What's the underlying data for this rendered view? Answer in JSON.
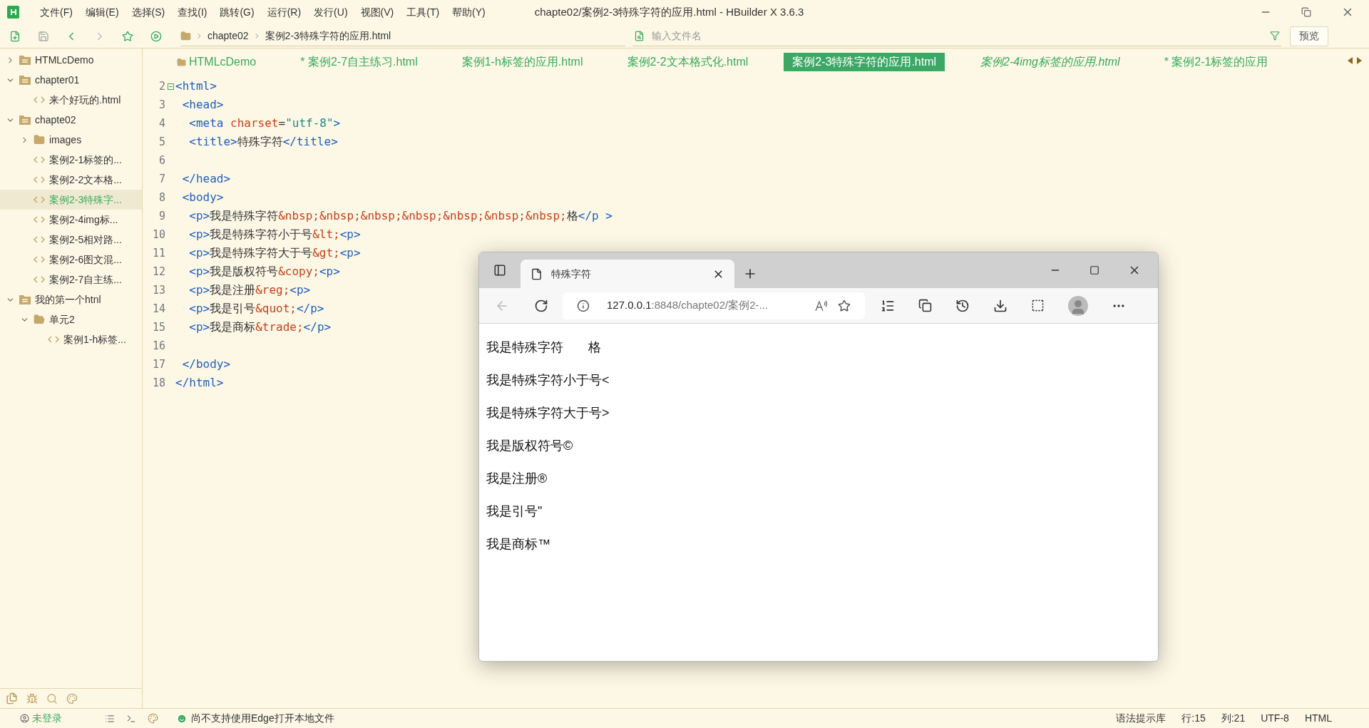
{
  "window": {
    "title": "chapte02/案例2-3特殊字符的应用.html - HBuilder X 3.6.3"
  },
  "menu": [
    "文件(F)",
    "编辑(E)",
    "选择(S)",
    "查找(I)",
    "跳转(G)",
    "运行(R)",
    "发行(U)",
    "视图(V)",
    "工具(T)",
    "帮助(Y)"
  ],
  "breadcrumb": [
    "chapte02",
    "案例2-3特殊字符的应用.html"
  ],
  "file_search": {
    "placeholder": "输入文件名"
  },
  "preview_button": "预览",
  "project_tree": [
    {
      "label": "HTMLcDemo",
      "kind": "project",
      "expanded": false,
      "selected": false
    },
    {
      "label": "chapter01",
      "kind": "project",
      "expanded": true,
      "selected": false,
      "children": [
        {
          "label": "来个好玩的.html",
          "kind": "file",
          "selected": false
        }
      ]
    },
    {
      "label": "chapte02",
      "kind": "project",
      "expanded": true,
      "selected": false,
      "children": [
        {
          "label": "images",
          "kind": "folder",
          "expanded": false,
          "selected": false
        },
        {
          "label": "案例2-1标签的...",
          "kind": "file",
          "selected": false
        },
        {
          "label": "案例2-2文本格...",
          "kind": "file",
          "selected": false
        },
        {
          "label": "案例2-3特殊字...",
          "kind": "file",
          "selected": true
        },
        {
          "label": "案例2-4img标...",
          "kind": "file",
          "selected": false
        },
        {
          "label": "案例2-5相对路...",
          "kind": "file",
          "selected": false
        },
        {
          "label": "案例2-6图文混...",
          "kind": "file",
          "selected": false
        },
        {
          "label": "案例2-7自主练...",
          "kind": "file",
          "selected": false
        }
      ]
    },
    {
      "label": "我的第一个htnl",
      "kind": "project",
      "expanded": true,
      "selected": false,
      "children": [
        {
          "label": "单元2",
          "kind": "open-folder",
          "expanded": true,
          "selected": false,
          "children": [
            {
              "label": "案例1-h标签...",
              "kind": "file",
              "selected": false
            }
          ]
        }
      ]
    }
  ],
  "editor_tabs": [
    {
      "label": "HTMLcDemo",
      "kind": "project",
      "selected": false,
      "italic": false
    },
    {
      "label": "* 案例2-7自主练习.html",
      "kind": "file",
      "selected": false,
      "italic": false
    },
    {
      "label": "案例1-h标签的应用.html",
      "kind": "file",
      "selected": false,
      "italic": false
    },
    {
      "label": "案例2-2文本格式化.html",
      "kind": "file",
      "selected": false,
      "italic": false
    },
    {
      "label": "案例2-3特殊字符的应用.html",
      "kind": "file",
      "selected": true,
      "italic": false
    },
    {
      "label": "案例2-4img标签的应用.html",
      "kind": "file",
      "selected": false,
      "italic": true
    },
    {
      "label": "* 案例2-1标签的应用",
      "kind": "file",
      "selected": false,
      "italic": false
    }
  ],
  "code_lines": [
    {
      "number": "2",
      "fold": true,
      "tokens": [
        {
          "kind": "tag",
          "text": "<html>"
        }
      ]
    },
    {
      "number": "3",
      "tokens": [
        {
          "kind": "tag",
          "text": " <head>"
        }
      ]
    },
    {
      "number": "4",
      "tokens": [
        {
          "kind": "tag",
          "text": "  <meta "
        },
        {
          "kind": "attr",
          "text": "charset"
        },
        {
          "kind": "text",
          "text": "="
        },
        {
          "kind": "string",
          "text": "\"utf-8\""
        },
        {
          "kind": "tag",
          "text": ">"
        }
      ]
    },
    {
      "number": "5",
      "tokens": [
        {
          "kind": "tag",
          "text": "  <title>"
        },
        {
          "kind": "text",
          "text": "特殊字符"
        },
        {
          "kind": "tag",
          "text": "</title>"
        }
      ]
    },
    {
      "number": "6"
    },
    {
      "number": "7",
      "tokens": [
        {
          "kind": "tag",
          "text": " </head>"
        }
      ]
    },
    {
      "number": "8",
      "tokens": [
        {
          "kind": "tag",
          "text": " <body>"
        }
      ]
    },
    {
      "number": "9",
      "tokens": [
        {
          "kind": "tag",
          "text": "  <p>"
        },
        {
          "kind": "text",
          "text": "我是特殊字符"
        },
        {
          "kind": "entity",
          "text": "&nbsp;&nbsp;&nbsp;&nbsp;&nbsp;&nbsp;&nbsp;"
        },
        {
          "kind": "text",
          "text": "格"
        },
        {
          "kind": "tag",
          "text": "</p >"
        }
      ]
    },
    {
      "number": "10",
      "tokens": [
        {
          "kind": "tag",
          "text": "  <p>"
        },
        {
          "kind": "text",
          "text": "我是特殊字符小于号"
        },
        {
          "kind": "entity",
          "text": "&lt;"
        },
        {
          "kind": "tag",
          "text": "<p>"
        }
      ]
    },
    {
      "number": "11",
      "tokens": [
        {
          "kind": "tag",
          "text": "  <p>"
        },
        {
          "kind": "text",
          "text": "我是特殊字符大于号"
        },
        {
          "kind": "entity",
          "text": "&gt;"
        },
        {
          "kind": "tag",
          "text": "<p>"
        }
      ]
    },
    {
      "number": "12",
      "tokens": [
        {
          "kind": "tag",
          "text": "  <p>"
        },
        {
          "kind": "text",
          "text": "我是版权符号"
        },
        {
          "kind": "entity",
          "text": "&copy;"
        },
        {
          "kind": "tag",
          "text": "<p>"
        }
      ]
    },
    {
      "number": "13",
      "tokens": [
        {
          "kind": "tag",
          "text": "  <p>"
        },
        {
          "kind": "text",
          "text": "我是注册"
        },
        {
          "kind": "entity",
          "text": "&reg;"
        },
        {
          "kind": "tag",
          "text": "<p>"
        }
      ]
    },
    {
      "number": "14",
      "tokens": [
        {
          "kind": "tag",
          "text": "  <p>"
        },
        {
          "kind": "text",
          "text": "我是引号"
        },
        {
          "kind": "entity",
          "text": "&quot;"
        },
        {
          "kind": "tag",
          "text": "</p>"
        }
      ]
    },
    {
      "number": "15",
      "tokens": [
        {
          "kind": "tag",
          "text": "  <p>"
        },
        {
          "kind": "text",
          "text": "我是商标"
        },
        {
          "kind": "entity",
          "text": "&trade;"
        },
        {
          "kind": "tag",
          "text": "</p>"
        }
      ]
    },
    {
      "number": "16"
    },
    {
      "number": "17",
      "tokens": [
        {
          "kind": "tag",
          "text": " </body>"
        }
      ]
    },
    {
      "number": "18",
      "tokens": [
        {
          "kind": "tag",
          "text": "</html>"
        }
      ]
    }
  ],
  "browser": {
    "tab_title": "特殊字符",
    "address": "127.0.0.1",
    "address_rest": ":8848/chapte02/案例2-...",
    "paragraphs": [
      "我是特殊字符       格",
      "我是特殊字符小于号<",
      "我是特殊字符大于号>",
      "我是版权符号©",
      "我是注册®",
      "我是引号\"",
      "我是商标™"
    ]
  },
  "status_bar": {
    "user": "未登录",
    "message": "尚不支持使用Edge打开本地文件",
    "items": [
      "语法提示库",
      "行:15",
      "列:21",
      "UTF-8",
      "HTML"
    ]
  }
}
